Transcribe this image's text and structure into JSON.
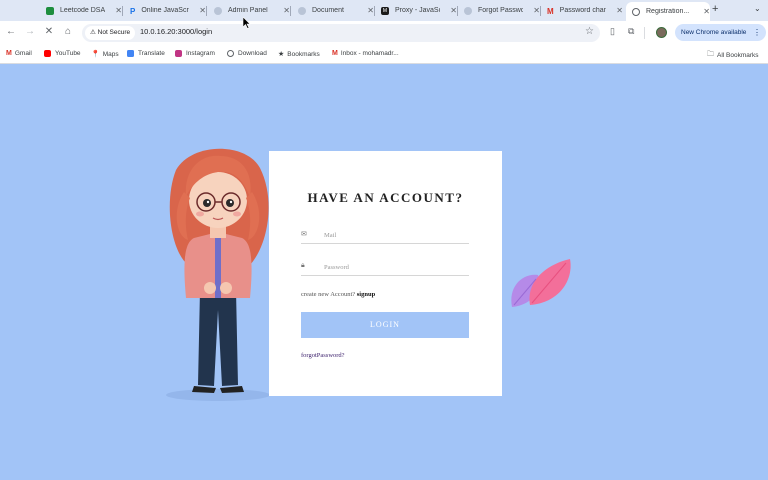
{
  "tabs": [
    {
      "title": "Leetcode DSA",
      "favicon": "sheets-icon",
      "color": "#1e8e3e"
    },
    {
      "title": "Online JavaScript",
      "favicon": "js-icon",
      "color": "#1a73e8"
    },
    {
      "title": "Admin Panel",
      "favicon": "globe-icon",
      "color": "#7f8ea5"
    },
    {
      "title": "Document",
      "favicon": "globe-icon",
      "color": "#7f8ea5"
    },
    {
      "title": "Proxy - JavaScript",
      "favicon": "mdn-icon",
      "color": "#1b1b1b"
    },
    {
      "title": "Forgot Password",
      "favicon": "globe-icon",
      "color": "#7f8ea5"
    },
    {
      "title": "Password chan...",
      "favicon": "gmail-icon",
      "color": "#d93025"
    },
    {
      "title": "Registration...",
      "favicon": "globe-icon",
      "color": "#5f6368"
    }
  ],
  "toolbar": {
    "security_label": "Not Secure",
    "url": "10.0.16.20:3000/login",
    "update_label": "New Chrome available"
  },
  "bookmarks": [
    {
      "label": "Gmail",
      "icon": "gmail-icon",
      "color": "#d93025"
    },
    {
      "label": "YouTube",
      "icon": "youtube-icon",
      "color": "#ff0000"
    },
    {
      "label": "Maps",
      "icon": "maps-icon",
      "color": "#34a853"
    },
    {
      "label": "Translate",
      "icon": "translate-icon",
      "color": "#4285f4"
    },
    {
      "label": "Instagram",
      "icon": "instagram-icon",
      "color": "#c13584"
    },
    {
      "label": "Download",
      "icon": "globe-icon",
      "color": "#5f6368"
    },
    {
      "label": "Bookmarks",
      "icon": "star-icon",
      "color": "#3c4043"
    },
    {
      "label": "Inbox - mohamadr...",
      "icon": "gmail-icon",
      "color": "#d93025"
    }
  ],
  "all_bookmarks_label": "All Bookmarks",
  "login": {
    "title": "HAVE AN ACCOUNT?",
    "mail_placeholder": "Mail",
    "password_placeholder": "Password",
    "signup_prompt": "create new Account?",
    "signup_link": "signup",
    "login_button": "LOGIN",
    "forgot_link": "forgotPassword?"
  },
  "colors": {
    "page_background": "#a2c4f7",
    "button": "#a2c4f7",
    "card": "#ffffff"
  }
}
